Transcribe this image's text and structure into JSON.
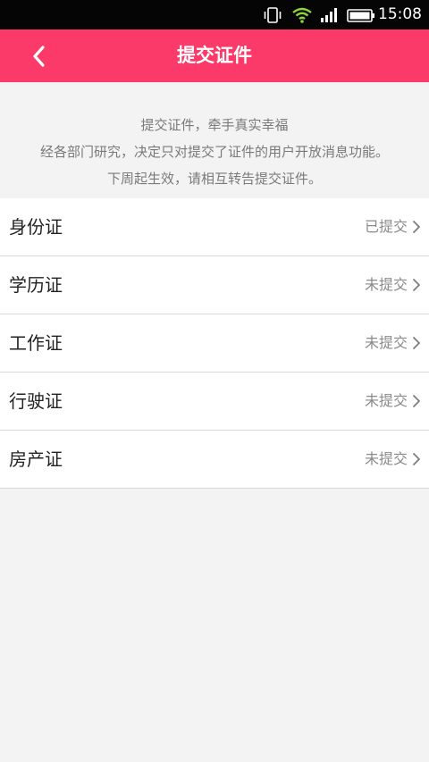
{
  "status_bar": {
    "time": "15:08",
    "icons": [
      "vibrate-icon",
      "wifi-icon",
      "signal-icon",
      "battery-icon"
    ]
  },
  "header": {
    "title": "提交证件",
    "back_icon": "chevron-left-icon",
    "background_color": "#fb3a6a"
  },
  "notice": {
    "lines": [
      "提交证件，牵手真实幸福",
      "经各部门研究，决定只对提交了证件的用户开放消息功能。",
      "下周起生效，请相互转告提交证件。"
    ]
  },
  "documents": [
    {
      "label": "身份证",
      "status": "已提交"
    },
    {
      "label": "学历证",
      "status": "未提交"
    },
    {
      "label": "工作证",
      "status": "未提交"
    },
    {
      "label": "行驶证",
      "status": "未提交"
    },
    {
      "label": "房产证",
      "status": "未提交"
    }
  ]
}
